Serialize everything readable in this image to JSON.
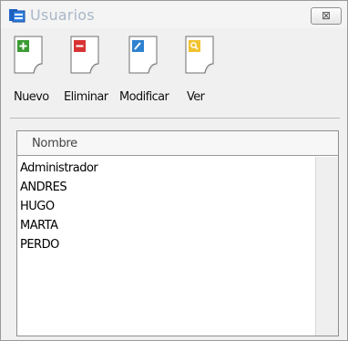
{
  "window": {
    "title": "Usuarios",
    "close_label": "⊠"
  },
  "toolbar": {
    "buttons": [
      {
        "label": "Nuevo",
        "icon": "add-document-icon",
        "color": "#3a9a33"
      },
      {
        "label": "Eliminar",
        "icon": "delete-document-icon",
        "color": "#d83333"
      },
      {
        "label": "Modificar",
        "icon": "edit-document-icon",
        "color": "#2f82d0"
      },
      {
        "label": "Ver",
        "icon": "view-document-icon",
        "color": "#f2c230"
      }
    ]
  },
  "list": {
    "column_header": "Nombre",
    "items": [
      "Administrador",
      "ANDRES",
      "HUGO",
      "MARTA",
      "PERDO"
    ]
  }
}
